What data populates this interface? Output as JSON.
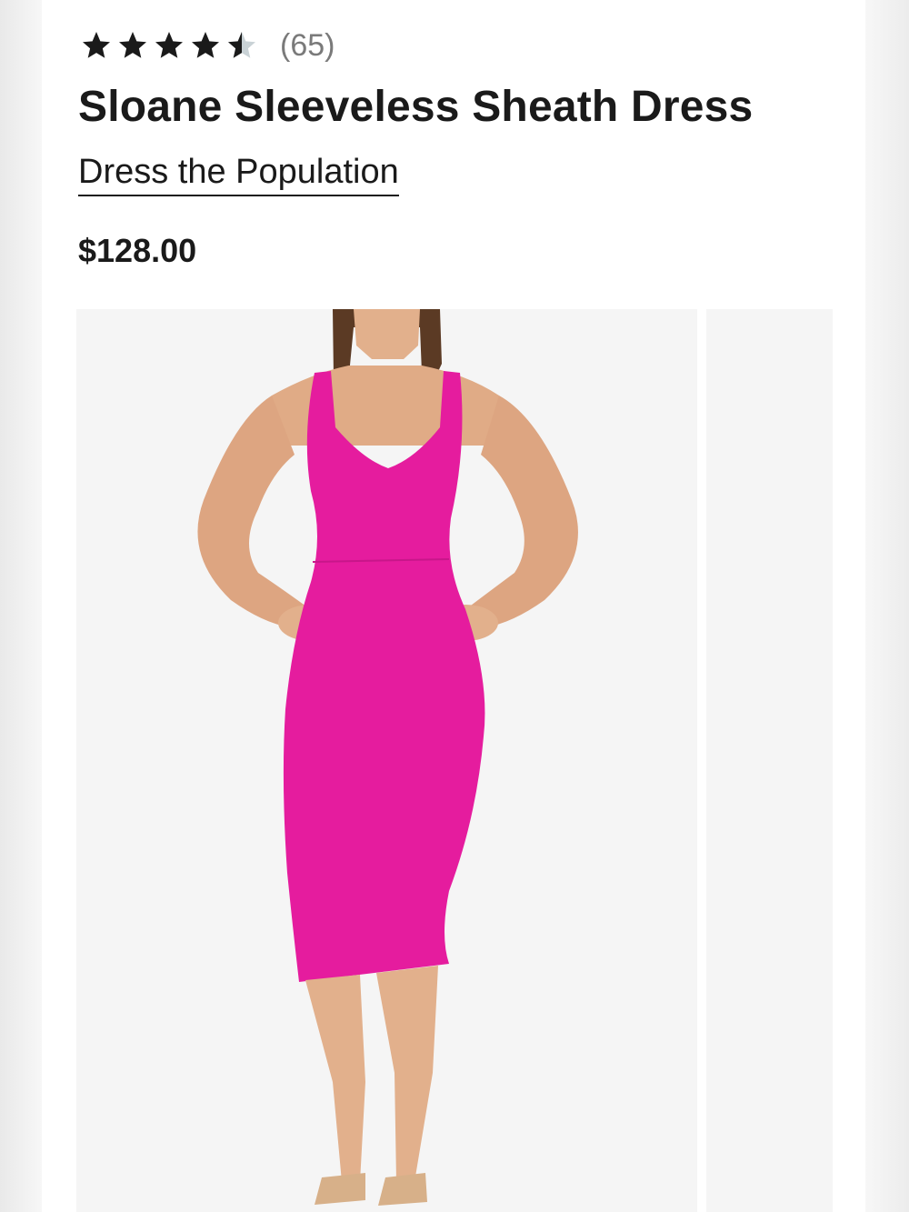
{
  "product": {
    "rating": 4.5,
    "review_count": "(65)",
    "title": "Sloane Sleeveless Sheath Dress",
    "brand": "Dress the Population",
    "price": "$128.00"
  },
  "gallery": {
    "main_image_alt": "pink-sleeveless-sheath-dress-photo",
    "dress_color": "#e51c9e"
  }
}
